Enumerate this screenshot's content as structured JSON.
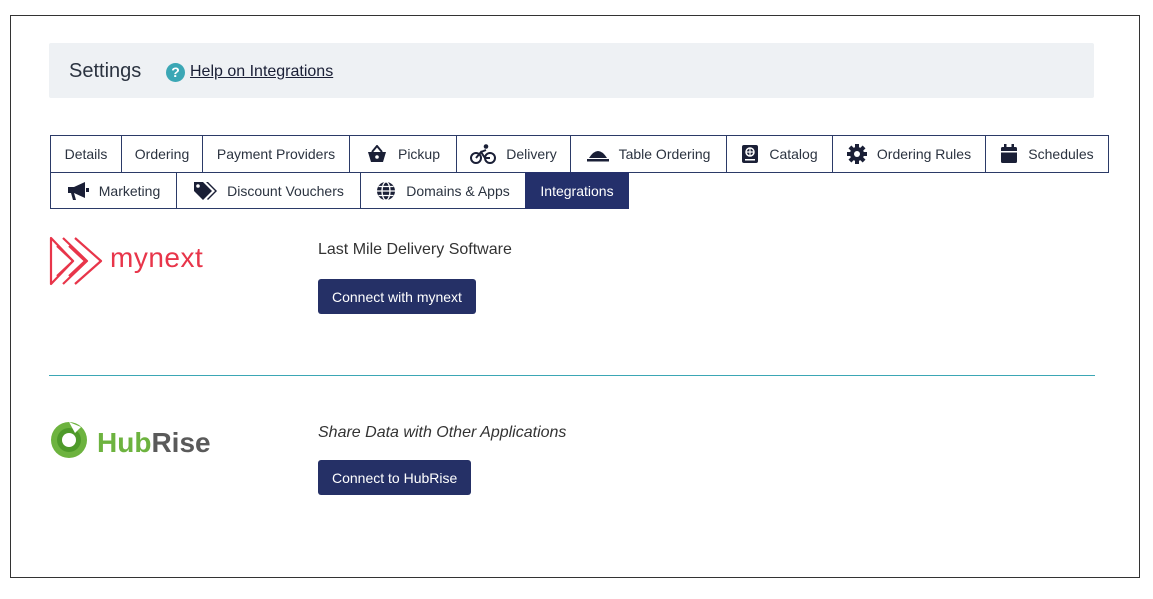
{
  "header": {
    "title": "Settings",
    "help_link": "Help on Integrations"
  },
  "tabs_row1": [
    "Details",
    "Ordering",
    "Payment Providers",
    "Pickup",
    "Delivery",
    "Table Ordering",
    "Catalog",
    "Ordering Rules",
    "Schedules"
  ],
  "tabs_row2": [
    "Marketing",
    "Discount Vouchers",
    "Domains & Apps",
    "Integrations"
  ],
  "active_tab": "Integrations",
  "integrations": [
    {
      "logo_text": "mynext",
      "tagline": "Last Mile Delivery Software",
      "button": "Connect with mynext",
      "brand_color": "#e8354a"
    },
    {
      "logo_text_part1": "Hub",
      "logo_text_part2": "Rise",
      "tagline": "Share Data with Other Applications",
      "button": "Connect to HubRise",
      "brand_color": "#6db33f"
    }
  ],
  "colors": {
    "accent": "#24306b",
    "help_icon": "#3ba7b5",
    "divider": "#3ba7b5"
  },
  "icons": {
    "pickup": "basket-icon",
    "delivery": "bicycle-icon",
    "table_ordering": "cloche-icon",
    "catalog": "catalog-book-icon",
    "ordering_rules": "gear-icon",
    "schedules": "calendar-icon",
    "marketing": "megaphone-icon",
    "discount_vouchers": "tags-icon",
    "domains_apps": "globe-icon",
    "help": "question-circle-icon"
  }
}
